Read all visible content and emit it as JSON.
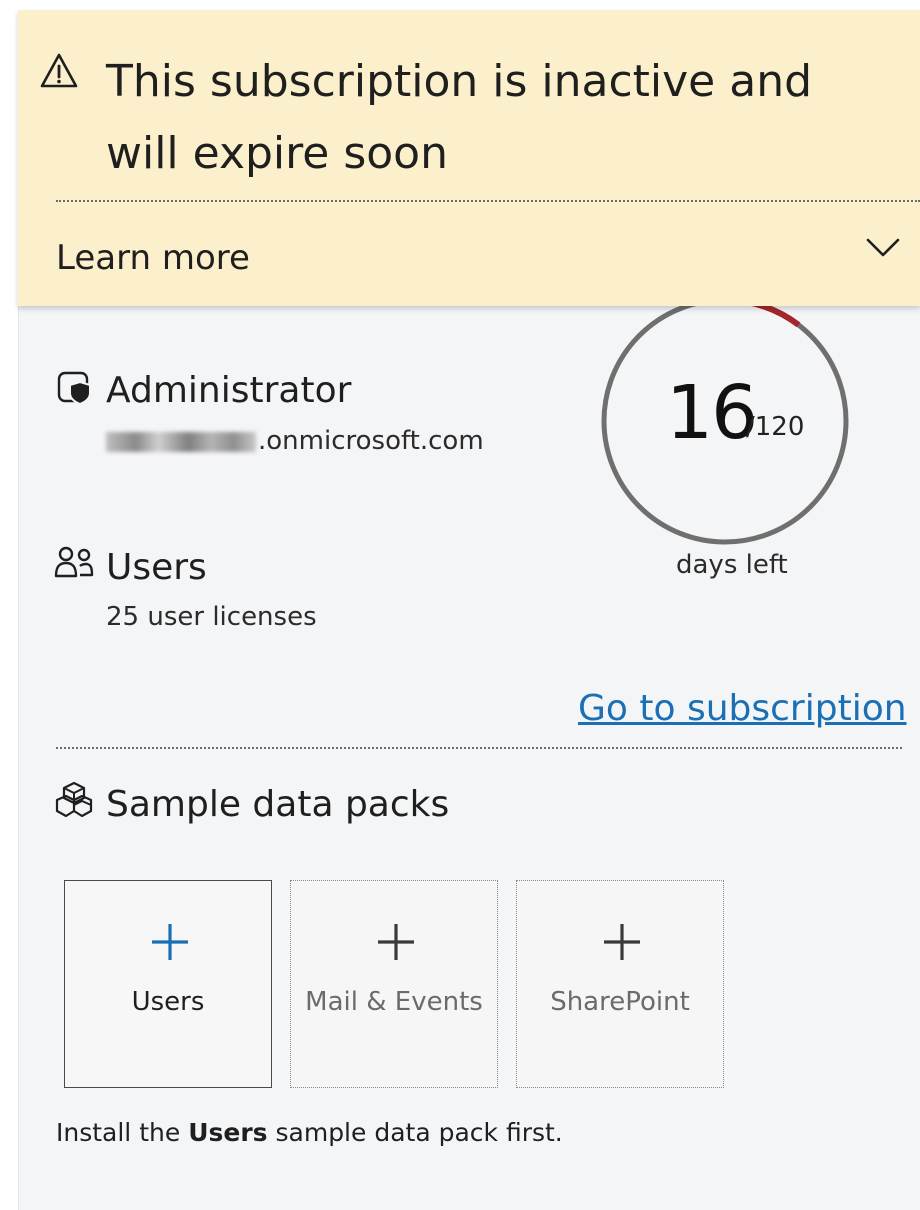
{
  "banner": {
    "title": "This subscription is inactive and will expire soon",
    "learn_more": "Learn more",
    "icon": "warning-icon",
    "background": "#fbf0cb"
  },
  "subscription": {
    "admin_label": "Administrator",
    "domain_suffix": ".onmicrosoft.com",
    "users_label": "Users",
    "users_detail": "25 user licenses",
    "days_remaining": "16",
    "days_total": "/120",
    "days_left_label": "days left",
    "go_link": "Go to subscription",
    "ring_colors": {
      "track": "#6f6f6f",
      "elapsed": "#a4262c"
    }
  },
  "sample_packs": {
    "title": "Sample data packs",
    "tiles": [
      {
        "label": "Users",
        "state": "active"
      },
      {
        "label": "Mail & Events",
        "state": "disabled"
      },
      {
        "label": "SharePoint",
        "state": "disabled"
      }
    ],
    "hint_prefix": "Install the ",
    "hint_bold": "Users",
    "hint_suffix": " sample data pack first.",
    "accent": "#1a6fb5"
  }
}
